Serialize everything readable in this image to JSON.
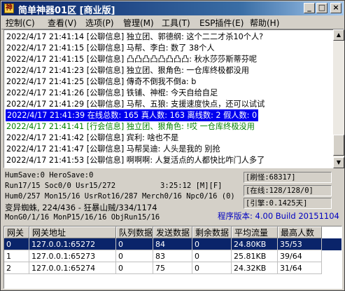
{
  "window": {
    "title": "简单神器01区 [商业版]"
  },
  "menu": [
    {
      "label": "控制(C)",
      "name": "menu-control"
    },
    {
      "label": "查看(V)",
      "name": "menu-view"
    },
    {
      "label": "选项(P)",
      "name": "menu-options"
    },
    {
      "label": "管理(M)",
      "name": "menu-manage"
    },
    {
      "label": "工具(T)",
      "name": "menu-tools"
    },
    {
      "label": "ESP插件(E)",
      "name": "menu-esp-plugins"
    },
    {
      "label": "帮助(H)",
      "name": "menu-help"
    }
  ],
  "log": [
    {
      "text": "2022/4/17 21:41:14 [公聊信息] 独立团、郭德纲: 这个二二才杀10个人?",
      "style": ""
    },
    {
      "text": "2022/4/17 21:41:15 [公聊信息] 马帮、李白:  数了  38个人",
      "style": ""
    },
    {
      "text": "2022/4/17 21:41:15 [公聊信息] 凸凸凸凸凸凸凸凸: 秋水莎莎斯蒂芬呢",
      "style": ""
    },
    {
      "text": "2022/4/17 21:41:23 [公聊信息] 独立团、狠角色: 一仓库终极都没用",
      "style": ""
    },
    {
      "text": "2022/4/17 21:41:25 [公聊信息] 傳奇不倒我不倒a:        b",
      "style": ""
    },
    {
      "text": "2022/4/17 21:41:26 [公聊信息] 铁铺、神棍: 今天自给自足",
      "style": ""
    },
    {
      "text": "2022/4/17 21:41:29 [公聊信息] 马帮、五狼: 支援速度快点，还可以试试",
      "style": ""
    },
    {
      "text": "2022/4/17 21:41:39 在线总数: 165 真人数: 163 离线数: 2 假人数: 0",
      "style": "sel"
    },
    {
      "text": "2022/4/17 21:41:41 [行会信息] 独立团、狠角色: !哎 一仓库终极没用",
      "style": "green"
    },
    {
      "text": "2022/4/17 21:41:42 [公聊信息] 宾利: 啥也不是",
      "style": ""
    },
    {
      "text": "2022/4/17 21:41:47 [公聊信息] 马帮吴迪: 人头是我的 别抢",
      "style": ""
    },
    {
      "text": "2022/4/17 21:41:53 [公聊信息] 啊啊啊: 人复活点的人都快比咋门人多了",
      "style": ""
    }
  ],
  "stats": {
    "line1": "HumSave:0 HeroSave:0",
    "line2": "Run17/15 Soc0/0 Usr15/272",
    "time": "3:25:12 [M][F]",
    "line3": "Hum0/257 Mon15/16 UsrRot16/287 Merch0/16 Npc0/16 (0)",
    "line4": "变异蜘蛛, 224/436 - 狂暴山贼/334/1174",
    "line5": "MonG0/1/16 MonP15/16/16 ObjRun15/16",
    "brush": "[刷怪:68317]",
    "online": "[在线:128/128/0]",
    "engine": "[引擎:0.1425天]",
    "version": "程序版本: 4.00 Build 20151104"
  },
  "grid": {
    "headers": [
      "网关",
      "网关地址",
      "队列数据",
      "发送数据",
      "剩余数据",
      "平均流量",
      "最高人数"
    ],
    "rows": [
      [
        "0",
        "127.0.0.1:65272",
        "0",
        "84",
        "0",
        "24.80KB",
        "35/53"
      ],
      [
        "1",
        "127.0.0.1:65273",
        "0",
        "83",
        "0",
        "25.81KB",
        "39/64"
      ],
      [
        "2",
        "127.0.0.1:65274",
        "0",
        "75",
        "0",
        "24.32KB",
        "31/64"
      ]
    ]
  },
  "colors": {
    "title_start": "#0a246a",
    "selected_log": "#0000ee",
    "guild_text": "#008000",
    "version_text": "#0000c0",
    "selected_row": "#0a246a"
  }
}
